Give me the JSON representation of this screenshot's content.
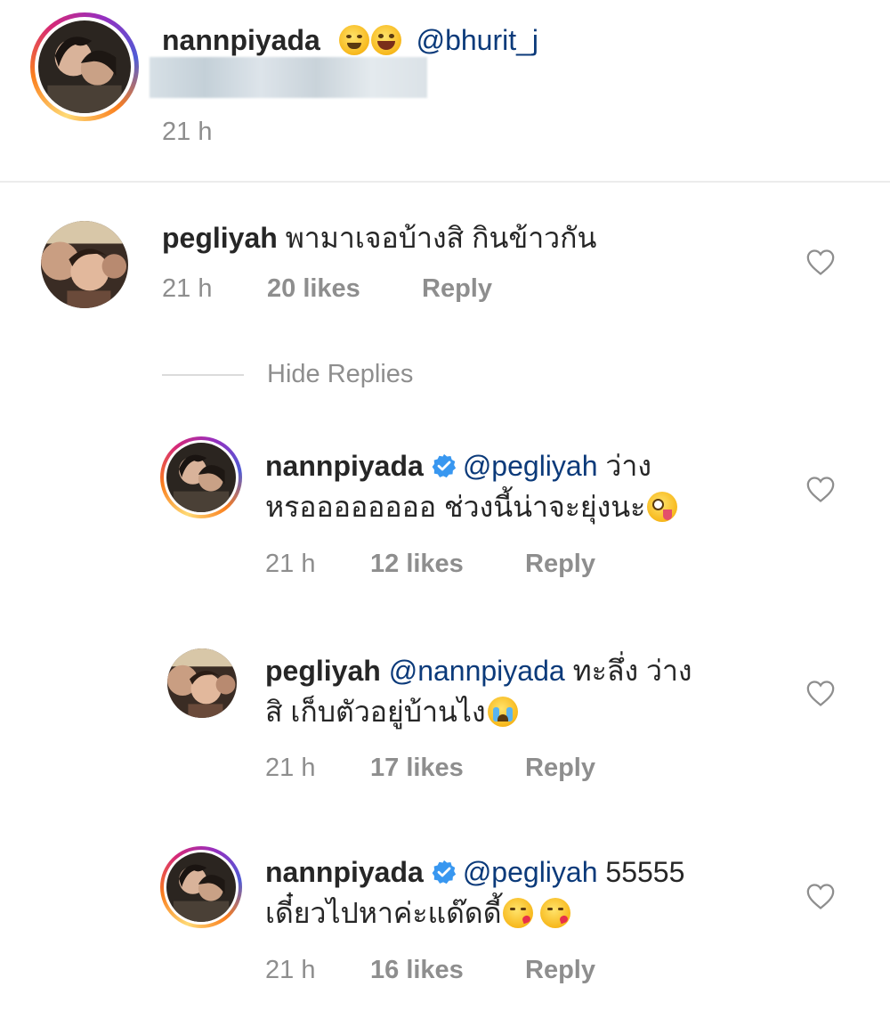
{
  "post": {
    "username": "nannpiyada",
    "emojis": [
      "smiling-face-emoji",
      "grinning-face-emoji"
    ],
    "mention": "@bhurit_j",
    "time": "21 h"
  },
  "comments": [
    {
      "username": "pegliyah",
      "text": "พามาเจอบ้างสิ กินข้าวกัน",
      "time": "21 h",
      "likes": "20 likes",
      "reply": "Reply"
    }
  ],
  "replies_toggle": {
    "label": "Hide Replies"
  },
  "replies": [
    {
      "username": "nannpiyada",
      "verified": true,
      "mention": "@pegliyah",
      "text_line1_tail": " ว่าง",
      "text_line2": "หรออออออออ ช่วงนี้น่าจะยุ่งนะ",
      "emoji": "zany-face-emoji",
      "time": "21 h",
      "likes": "12 likes",
      "reply": "Reply"
    },
    {
      "username": "pegliyah",
      "verified": false,
      "mention": "@nannpiyada",
      "text_line1_tail": " ทะลึ่ง ว่าง",
      "text_line2": "สิ เก็บตัวอยู่บ้านไง",
      "emoji": "loudly-crying-face-emoji",
      "time": "21 h",
      "likes": "17 likes",
      "reply": "Reply"
    },
    {
      "username": "nannpiyada",
      "verified": true,
      "mention": "@pegliyah",
      "text_line1_tail": " 55555",
      "text_line2": "เดี๋ยวไปหาค่ะแด๊ดดี้",
      "emoji": "face-blowing-kiss-emoji",
      "time": "21 h",
      "likes": "16 likes",
      "reply": "Reply"
    }
  ],
  "colors": {
    "text": "#262626",
    "meta": "#8e8e8e",
    "mention": "#0b3a7a",
    "verified": "#3897f0",
    "divider": "#ececec"
  }
}
